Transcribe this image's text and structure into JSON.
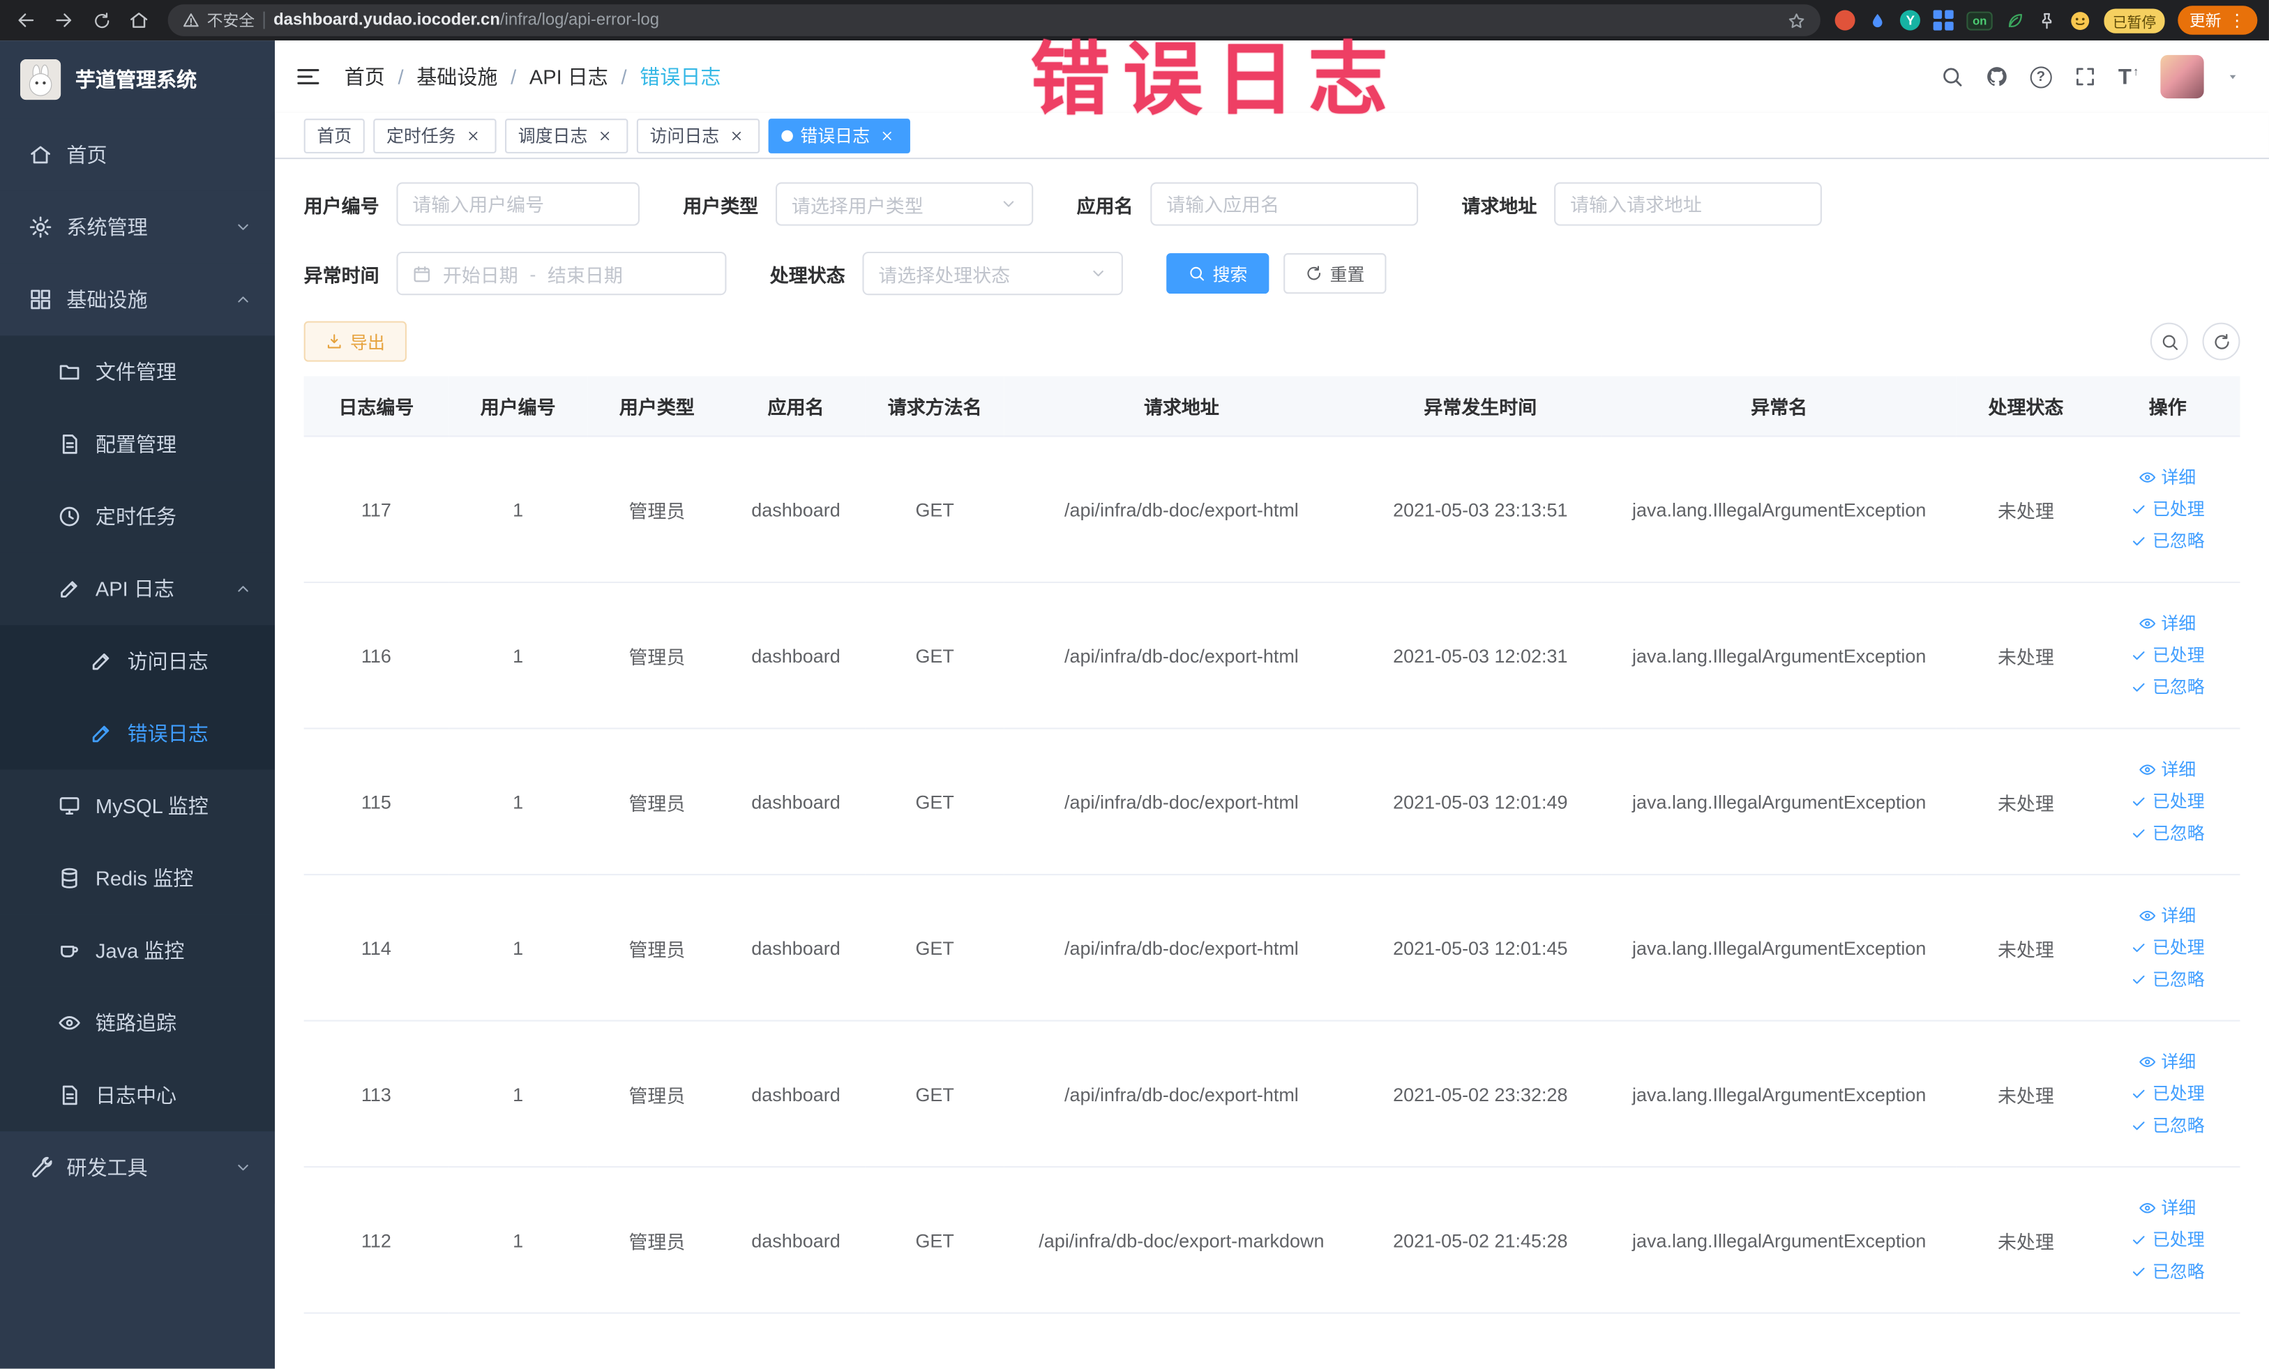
{
  "browser": {
    "security": "不安全",
    "url_domain": "dashboard.yudao.iocoder.cn",
    "url_path": "/infra/log/api-error-log",
    "extension_y_label": "Y",
    "extension_on_label": "on",
    "paused_badge": "已暂停",
    "update_label": "更新"
  },
  "annotation": "错误日志",
  "sidebar": {
    "title": "芋道管理系统",
    "items": [
      {
        "name": "home",
        "icon": "home",
        "label": "首页",
        "level": 0
      },
      {
        "name": "system",
        "icon": "gear",
        "label": "系统管理",
        "level": 0,
        "arrow": "down"
      },
      {
        "name": "infra",
        "icon": "grid",
        "label": "基础设施",
        "level": 0,
        "arrow": "up"
      },
      {
        "name": "file",
        "icon": "folder",
        "label": "文件管理",
        "level": 1
      },
      {
        "name": "config",
        "icon": "doc",
        "label": "配置管理",
        "level": 1
      },
      {
        "name": "job",
        "icon": "clock",
        "label": "定时任务",
        "level": 1
      },
      {
        "name": "api-log",
        "icon": "edit",
        "label": "API 日志",
        "level": 1,
        "arrow": "up"
      },
      {
        "name": "access-log",
        "icon": "edit",
        "label": "访问日志",
        "level": 2
      },
      {
        "name": "error-log",
        "icon": "edit",
        "label": "错误日志",
        "level": 2,
        "active": true
      },
      {
        "name": "mysql",
        "icon": "monitor",
        "label": "MySQL 监控",
        "level": 1
      },
      {
        "name": "redis",
        "icon": "db",
        "label": "Redis 监控",
        "level": 1
      },
      {
        "name": "java",
        "icon": "coffee",
        "label": "Java 监控",
        "level": 1
      },
      {
        "name": "tracer",
        "icon": "eye",
        "label": "链路追踪",
        "level": 1
      },
      {
        "name": "log-center",
        "icon": "doc",
        "label": "日志中心",
        "level": 1
      },
      {
        "name": "dev-tools",
        "icon": "wrench",
        "label": "研发工具",
        "level": 0,
        "arrow": "down"
      }
    ]
  },
  "breadcrumb": [
    "首页",
    "基础设施",
    "API 日志",
    "错误日志"
  ],
  "tags": [
    {
      "name": "home",
      "label": "首页",
      "closable": false,
      "active": false
    },
    {
      "name": "job",
      "label": "定时任务",
      "closable": true,
      "active": false
    },
    {
      "name": "job-log",
      "label": "调度日志",
      "closable": true,
      "active": false
    },
    {
      "name": "access-log",
      "label": "访问日志",
      "closable": true,
      "active": false
    },
    {
      "name": "error-log",
      "label": "错误日志",
      "closable": true,
      "active": true
    }
  ],
  "filters": {
    "user_id": {
      "label": "用户编号",
      "placeholder": "请输入用户编号"
    },
    "user_type": {
      "label": "用户类型",
      "placeholder": "请选择用户类型"
    },
    "app_name": {
      "label": "应用名",
      "placeholder": "请输入应用名"
    },
    "request_url": {
      "label": "请求地址",
      "placeholder": "请输入请求地址"
    },
    "exception_time": {
      "label": "异常时间",
      "start": "开始日期",
      "separator": "-",
      "end": "结束日期"
    },
    "status": {
      "label": "处理状态",
      "placeholder": "请选择处理状态"
    },
    "search": "搜索",
    "reset": "重置"
  },
  "toolbar": {
    "export": "导出"
  },
  "table": {
    "columns": [
      "日志编号",
      "用户编号",
      "用户类型",
      "应用名",
      "请求方法名",
      "请求地址",
      "异常发生时间",
      "异常名",
      "处理状态",
      "操作"
    ],
    "actions": {
      "detail": "详细",
      "processed": "已处理",
      "ignored": "已忽略"
    },
    "rows": [
      {
        "log_id": "117",
        "user_id": "1",
        "user_type": "管理员",
        "app": "dashboard",
        "method": "GET",
        "url": "/api/infra/db-doc/export-html",
        "time": "2021-05-03 23:13:51",
        "exception": "java.lang.IllegalArgumentException",
        "status": "未处理"
      },
      {
        "log_id": "116",
        "user_id": "1",
        "user_type": "管理员",
        "app": "dashboard",
        "method": "GET",
        "url": "/api/infra/db-doc/export-html",
        "time": "2021-05-03 12:02:31",
        "exception": "java.lang.IllegalArgumentException",
        "status": "未处理"
      },
      {
        "log_id": "115",
        "user_id": "1",
        "user_type": "管理员",
        "app": "dashboard",
        "method": "GET",
        "url": "/api/infra/db-doc/export-html",
        "time": "2021-05-03 12:01:49",
        "exception": "java.lang.IllegalArgumentException",
        "status": "未处理"
      },
      {
        "log_id": "114",
        "user_id": "1",
        "user_type": "管理员",
        "app": "dashboard",
        "method": "GET",
        "url": "/api/infra/db-doc/export-html",
        "time": "2021-05-03 12:01:45",
        "exception": "java.lang.IllegalArgumentException",
        "status": "未处理"
      },
      {
        "log_id": "113",
        "user_id": "1",
        "user_type": "管理员",
        "app": "dashboard",
        "method": "GET",
        "url": "/api/infra/db-doc/export-html",
        "time": "2021-05-02 23:32:28",
        "exception": "java.lang.IllegalArgumentException",
        "status": "未处理"
      },
      {
        "log_id": "112",
        "user_id": "1",
        "user_type": "管理员",
        "app": "dashboard",
        "method": "GET",
        "url": "/api/infra/db-doc/export-markdown",
        "time": "2021-05-02 21:45:28",
        "exception": "java.lang.IllegalArgumentException",
        "status": "未处理"
      }
    ]
  }
}
